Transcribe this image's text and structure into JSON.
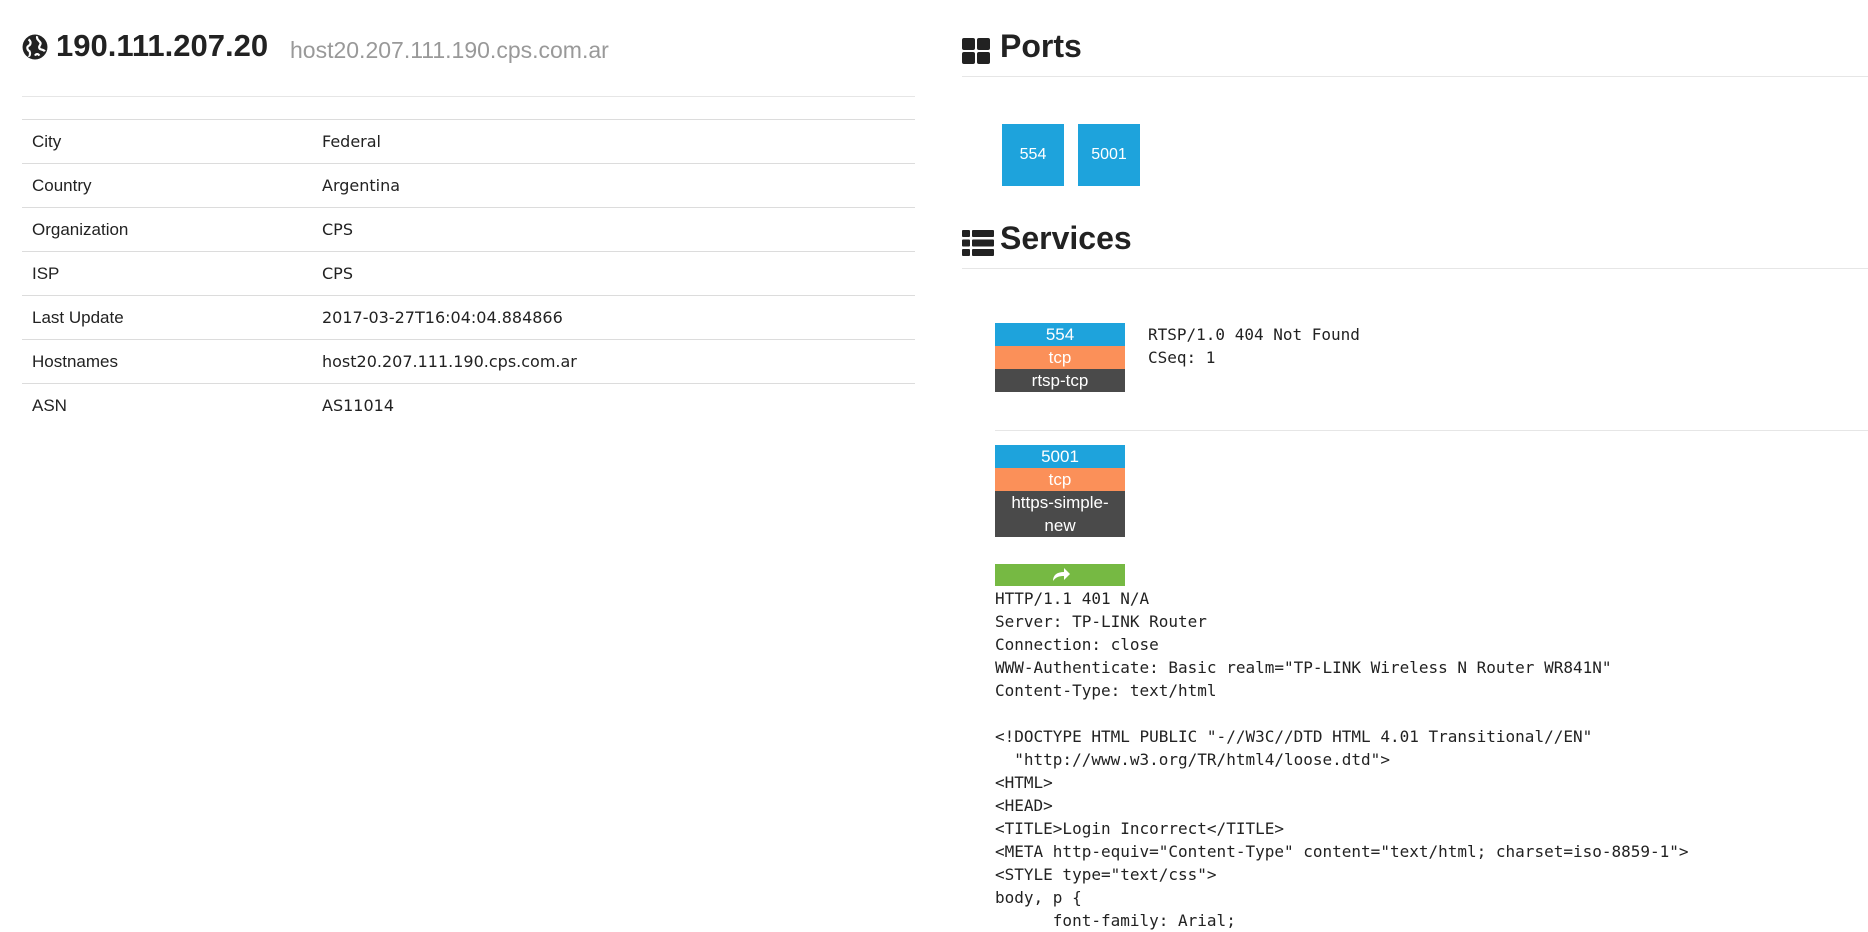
{
  "host": {
    "ip": "190.111.207.20",
    "hostname": "host20.207.111.190.cps.com.ar"
  },
  "info": [
    {
      "key": "City",
      "value": "Federal"
    },
    {
      "key": "Country",
      "value": "Argentina"
    },
    {
      "key": "Organization",
      "value": "CPS"
    },
    {
      "key": "ISP",
      "value": "CPS"
    },
    {
      "key": "Last Update",
      "value": "2017-03-27T16:04:04.884866"
    },
    {
      "key": "Hostnames",
      "value": "host20.207.111.190.cps.com.ar"
    },
    {
      "key": "ASN",
      "value": "AS11014"
    }
  ],
  "ports": {
    "title": "Ports",
    "list": [
      "554",
      "5001"
    ]
  },
  "services": {
    "title": "Services",
    "items": [
      {
        "port": "554",
        "proto": "tcp",
        "name": "rtsp-tcp",
        "banner": "RTSP/1.0 404 Not Found\nCSeq: 1"
      },
      {
        "port": "5001",
        "proto": "tcp",
        "name": "https-simple-new",
        "banner": "HTTP/1.1 401 N/A\nServer: TP-LINK Router\nConnection: close\nWWW-Authenticate: Basic realm=\"TP-LINK Wireless N Router WR841N\"\nContent-Type: text/html\n\n<!DOCTYPE HTML PUBLIC \"-//W3C//DTD HTML 4.01 Transitional//EN\"\n  \"http://www.w3.org/TR/html4/loose.dtd\">\n<HTML>\n<HEAD>\n<TITLE>Login Incorrect</TITLE>\n<META http-equiv=\"Content-Type\" content=\"text/html; charset=iso-8859-1\">\n<STYLE type=\"text/css\">\nbody, p {\n      font-family: Arial;"
      }
    ]
  },
  "colors": {
    "port_blue": "#1ea3dc",
    "proto_orange": "#fb9059",
    "name_dark": "#4a4a4a",
    "redirect_green": "#76b943"
  },
  "icons": {
    "host": "globe-icon",
    "ports": "grid-icon",
    "services": "list-icon",
    "redirect": "share-arrow-icon"
  }
}
